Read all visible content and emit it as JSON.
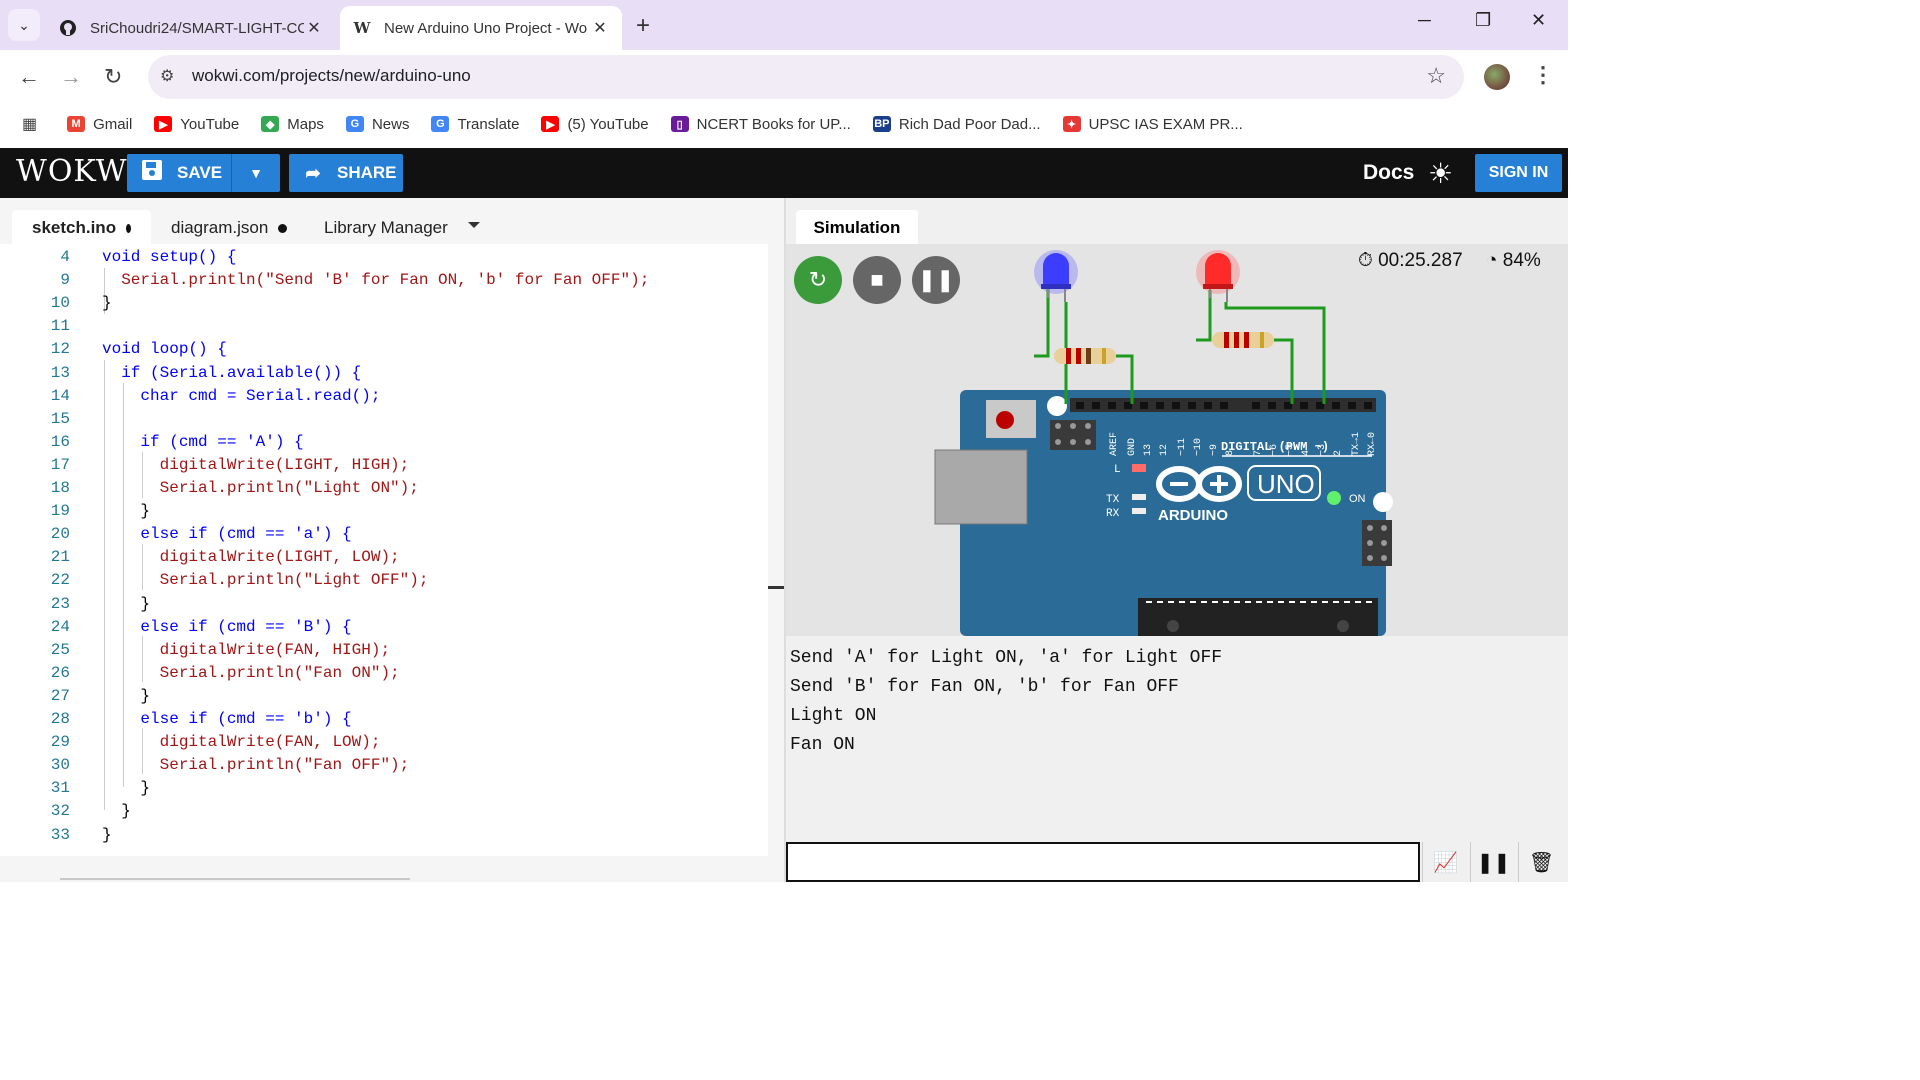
{
  "browser": {
    "tabs": [
      {
        "title": "SriChoudri24/SMART-LIGHT-CC",
        "favicon": "github-icon"
      },
      {
        "title": "New Arduino Uno Project - Wo",
        "favicon": "wokwi-icon"
      }
    ],
    "url": "wokwi.com/projects/new/arduino-uno",
    "bookmarks": [
      {
        "label": "Gmail",
        "color": "#ea4335"
      },
      {
        "label": "YouTube",
        "color": "#ff0000"
      },
      {
        "label": "Maps",
        "color": "#34a853"
      },
      {
        "label": "News",
        "color": "#4285f4"
      },
      {
        "label": "Translate",
        "color": "#4285f4"
      },
      {
        "label": "(5) YouTube",
        "color": "#ff0000"
      },
      {
        "label": "NCERT Books for UP...",
        "color": "#6a1b9a"
      },
      {
        "label": "Rich Dad Poor Dad...",
        "color": "#1a3e8c"
      },
      {
        "label": "UPSC IAS EXAM PR...",
        "color": "#e53935"
      }
    ]
  },
  "wokwi": {
    "logo": "WOKWi",
    "save_label": "SAVE",
    "share_label": "SHARE",
    "docs_label": "Docs",
    "signin_label": "SIGN IN",
    "accent": "#2680d6"
  },
  "editor": {
    "tabs": [
      {
        "label": "sketch.ino",
        "modified": true
      },
      {
        "label": "diagram.json",
        "modified": true
      },
      {
        "label": "Library Manager",
        "modified": false
      }
    ],
    "lines": [
      {
        "n": "4",
        "text": "void setup() {"
      },
      {
        "n": "9",
        "text": "  Serial.println(\"Send 'B' for Fan ON, 'b' for Fan OFF\");"
      },
      {
        "n": "10",
        "text": "}"
      },
      {
        "n": "11",
        "text": ""
      },
      {
        "n": "12",
        "text": "void loop() {"
      },
      {
        "n": "13",
        "text": "  if (Serial.available()) {"
      },
      {
        "n": "14",
        "text": "    char cmd = Serial.read();"
      },
      {
        "n": "15",
        "text": ""
      },
      {
        "n": "16",
        "text": "    if (cmd == 'A') {"
      },
      {
        "n": "17",
        "text": "      digitalWrite(LIGHT, HIGH);"
      },
      {
        "n": "18",
        "text": "      Serial.println(\"Light ON\");"
      },
      {
        "n": "19",
        "text": "    }"
      },
      {
        "n": "20",
        "text": "    else if (cmd == 'a') {"
      },
      {
        "n": "21",
        "text": "      digitalWrite(LIGHT, LOW);"
      },
      {
        "n": "22",
        "text": "      Serial.println(\"Light OFF\");"
      },
      {
        "n": "23",
        "text": "    }"
      },
      {
        "n": "24",
        "text": "    else if (cmd == 'B') {"
      },
      {
        "n": "25",
        "text": "      digitalWrite(FAN, HIGH);"
      },
      {
        "n": "26",
        "text": "      Serial.println(\"Fan ON\");"
      },
      {
        "n": "27",
        "text": "    }"
      },
      {
        "n": "28",
        "text": "    else if (cmd == 'b') {"
      },
      {
        "n": "29",
        "text": "      digitalWrite(FAN, LOW);"
      },
      {
        "n": "30",
        "text": "      Serial.println(\"Fan OFF\");"
      },
      {
        "n": "31",
        "text": "    }"
      },
      {
        "n": "32",
        "text": "  }"
      },
      {
        "n": "33",
        "text": "}"
      }
    ]
  },
  "simulation": {
    "tab_label": "Simulation",
    "timer": "00:25.287",
    "speed": "84%",
    "board": {
      "uno_label": "UNO",
      "arduino_label": "ARDUINO",
      "digital_label": "DIGITAL (PWM ~)",
      "on_label": "ON",
      "l_label": "L",
      "tx_label": "TX",
      "rx_label": "RX",
      "pin_labels": [
        "AREF",
        "GND",
        "13",
        "12",
        "~11",
        "~10",
        "~9",
        "8",
        "7",
        "~6",
        "~5",
        "4",
        "~3",
        "2",
        "TX→1",
        "RX←0"
      ]
    },
    "leds": [
      {
        "color": "blue",
        "hex": "#3d3dff"
      },
      {
        "color": "red",
        "hex": "#ff2a2a"
      }
    ],
    "serial_output": [
      "Send 'A' for Light ON, 'a' for Light OFF",
      "Send 'B' for Fan ON, 'b' for Fan OFF",
      "Light ON",
      "Fan ON"
    ]
  }
}
